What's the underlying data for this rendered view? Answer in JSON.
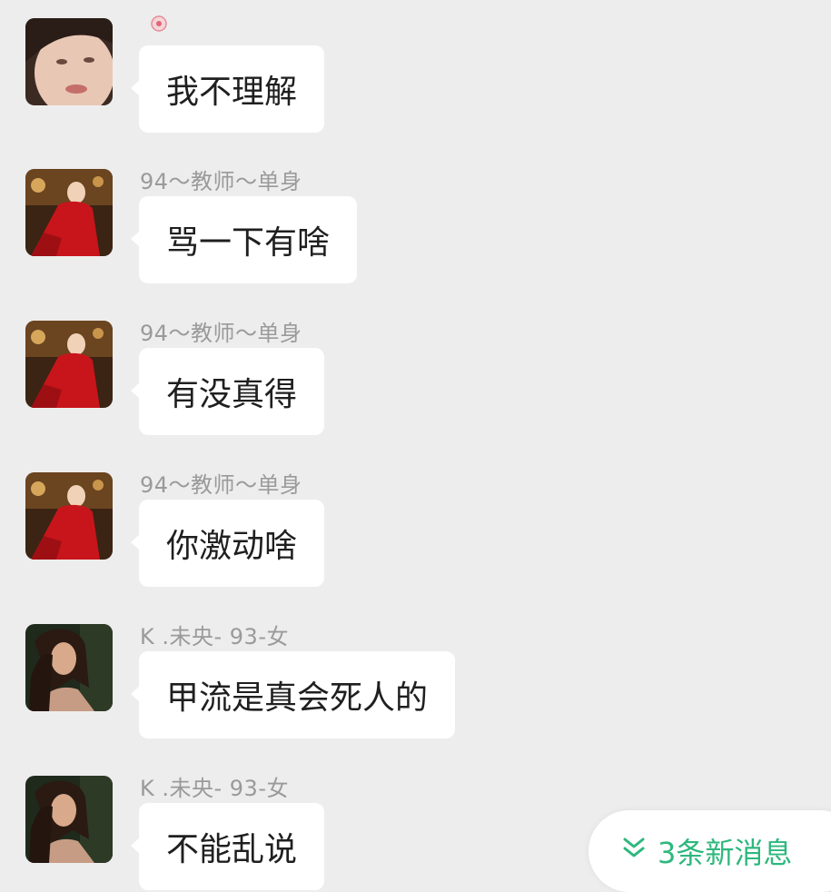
{
  "colors": {
    "background": "#ededed",
    "bubble": "#ffffff",
    "sender_text": "#9a9a9a",
    "message_text": "#1f1f1f",
    "accent": "#2db87d"
  },
  "messages": [
    {
      "sender": "",
      "text": "我不理解",
      "avatar": "woman-closeup-avatar"
    },
    {
      "sender": "94～教师～单身",
      "text": "骂一下有啥",
      "avatar": "red-dress-avatar"
    },
    {
      "sender": "94～教师～单身",
      "text": "有没真得",
      "avatar": "red-dress-avatar"
    },
    {
      "sender": "94～教师～单身",
      "text": "你激动啥",
      "avatar": "red-dress-avatar"
    },
    {
      "sender": "K .未央- 93-女",
      "text": "甲流是真会死人的",
      "avatar": "dark-hair-avatar"
    },
    {
      "sender": "K .未央- 93-女",
      "text": "不能乱说",
      "avatar": "dark-hair-avatar"
    }
  ],
  "new_messages": {
    "label": "3条新消息",
    "icon": "double-chevron-down-icon"
  }
}
